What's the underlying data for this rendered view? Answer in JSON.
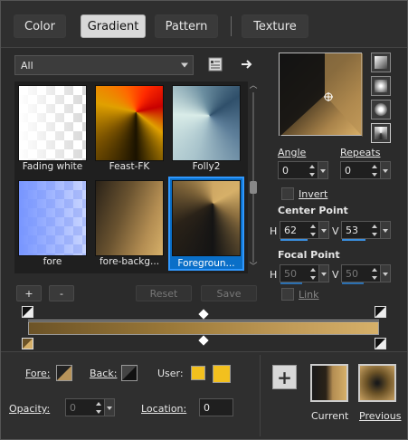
{
  "tabs": [
    {
      "label": "Color"
    },
    {
      "label": "Gradient",
      "active": true
    },
    {
      "label": "Pattern"
    },
    {
      "label": "Texture"
    }
  ],
  "category": {
    "selected": "All"
  },
  "icons": {
    "library": "library-icon",
    "arrow": "arrow-right-icon"
  },
  "gradients": [
    {
      "label": "Fading white"
    },
    {
      "label": "Feast-FK"
    },
    {
      "label": "Folly2"
    },
    {
      "label": "fore"
    },
    {
      "label": "fore-backg..."
    },
    {
      "label": "Foregroun...",
      "selected": true
    }
  ],
  "buttons": {
    "add": "+",
    "remove": "-",
    "reset": "Reset",
    "save": "Save"
  },
  "angle": {
    "label": "Angle",
    "value": "0"
  },
  "repeats": {
    "label": "Repeats",
    "value": "0"
  },
  "invert": {
    "label": "Invert",
    "checked": false
  },
  "center_point": {
    "label": "Center Point",
    "h_label": "H",
    "h_value": "62",
    "v_label": "V",
    "v_value": "53"
  },
  "focal_point": {
    "label": "Focal Point",
    "h_label": "H",
    "h_value": "50",
    "v_label": "V",
    "v_value": "50"
  },
  "link": {
    "label": "Link",
    "checked": false
  },
  "bottom": {
    "fore_label": "Fore:",
    "back_label": "Back:",
    "user_label": "User:",
    "opacity_label": "Opacity:",
    "opacity_value": "0",
    "location_label": "Location:",
    "location_value": "0",
    "add_label": "+",
    "current_label": "Current",
    "previous_label": "Previous"
  },
  "colors": {
    "accent": "#0a6fc8",
    "user_color": "#f2c01e",
    "gold": "#d6b069",
    "brown": "#6c5327"
  }
}
